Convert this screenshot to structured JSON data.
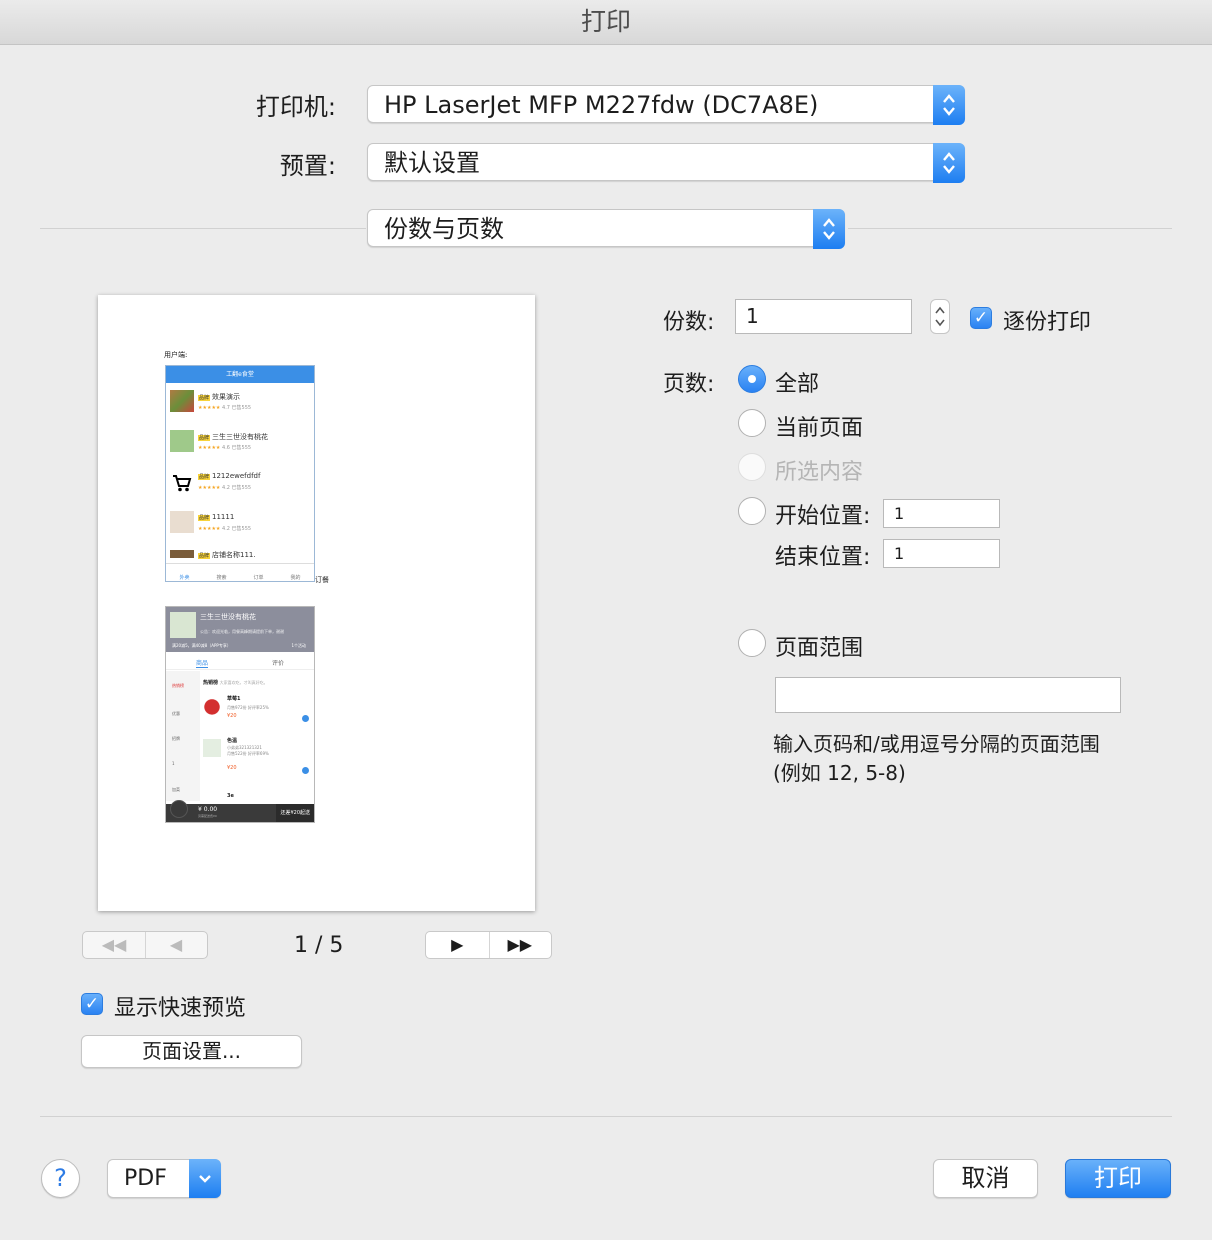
{
  "window": {
    "title": "打印"
  },
  "printer": {
    "label": "打印机:",
    "value": "HP LaserJet MFP M227fdw (DC7A8E)"
  },
  "preset": {
    "label": "预置:",
    "value": "默认设置"
  },
  "section": {
    "value": "份数与页数"
  },
  "preview": {
    "page_indicator": "1 / 5",
    "first_label": "◀◀",
    "prev_label": "◀",
    "next_label": "▶",
    "last_label": "▶▶",
    "content": {
      "caption1": "用户端:",
      "caption2": "订餐",
      "app_title": "工翻e食堂",
      "shops": [
        {
          "badge": "品牌",
          "name": "效果演示",
          "rating": "4.7  已售555"
        },
        {
          "badge": "品牌",
          "name": "三生三世没有桃花",
          "rating": "4.6  已售555"
        },
        {
          "badge": "品牌",
          "name": "1212ewefdfdf",
          "rating": "4.2  已售555"
        },
        {
          "badge": "品牌",
          "name": "11111",
          "rating": "4.2  已售555"
        },
        {
          "badge": "品牌",
          "name": "店铺名称111.",
          "rating": ""
        }
      ],
      "tabbar": [
        "外卖",
        "搜索",
        "订单",
        "我的"
      ],
      "store_name": "三生三世没有桃花",
      "store_notice": "公告：欢迎光临，用餐高峰期请提前下单，谢谢",
      "store_promo": "满20减5，满40减8（APP专享）",
      "promo_count": "1个活动",
      "tabs": [
        "商品",
        "评价"
      ],
      "categories": [
        "热销榜",
        "优惠",
        "招牌",
        "1",
        "加菜"
      ],
      "section_title": "热销榜",
      "section_sub": "大家喜欢吃，才叫真好吃。",
      "items": [
        {
          "name": "草莓1",
          "desc": "月售972份  好评率25%",
          "price": "¥20"
        },
        {
          "name": "色温",
          "desc": "小弟弟321321321",
          "desc2": "月售522份  好评率69%",
          "price": "¥20"
        },
        {
          "name": "3e",
          "desc": "",
          "price": ""
        }
      ],
      "cart_total": "¥ 0.00",
      "cart_sub": "另需配送费¥0",
      "cart_cta": "还差¥20起送"
    }
  },
  "copies": {
    "label": "份数:",
    "value": "1",
    "collate_label": "逐份打印",
    "collate_checked": true
  },
  "pages": {
    "label": "页数:",
    "options": {
      "all": "全部",
      "current": "当前页面",
      "selection": "所选内容",
      "from": "开始位置:",
      "to": "结束位置:",
      "range": "页面范围"
    },
    "selected": "all",
    "from_value": "1",
    "to_value": "1",
    "range_value": "",
    "range_hint": "输入页码和/或用逗号分隔的页面范围(例如 12, 5-8)"
  },
  "quick_preview": {
    "label": "显示快速预览",
    "checked": true
  },
  "page_setup_button": "页面设置...",
  "footer": {
    "help_label": "?",
    "pdf_label": "PDF",
    "cancel_label": "取消",
    "print_label": "打印"
  },
  "colors": {
    "accent": "#1f7ff1",
    "background": "#ececec"
  }
}
